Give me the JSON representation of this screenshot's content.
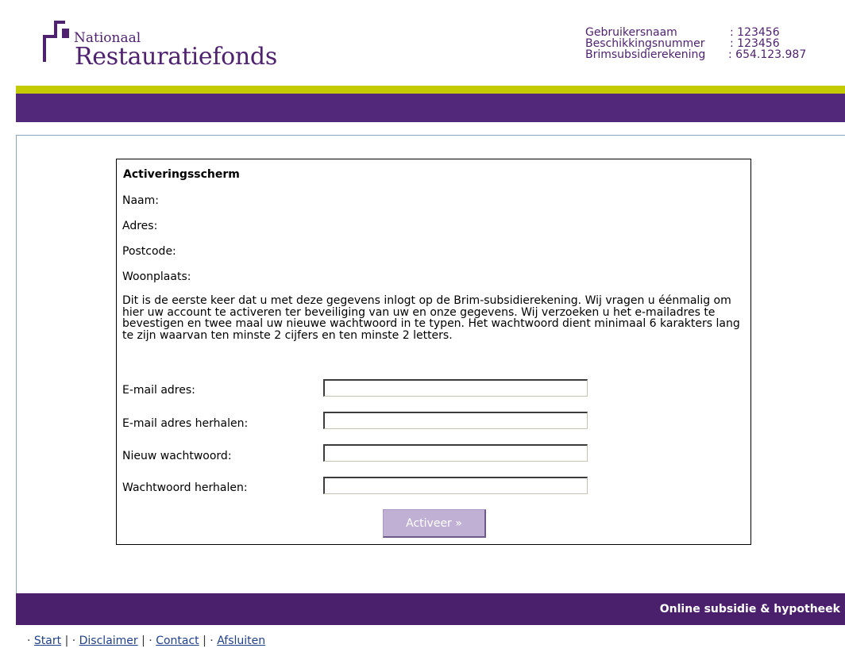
{
  "brand": {
    "line1": "Nationaal",
    "line2": "Restauratiefonds",
    "color": "#4f2270"
  },
  "userinfo": [
    {
      "label": "Gebruikersnaam",
      "value": ": 123456"
    },
    {
      "label": "Beschikkingsnummer",
      "value": ": 123456"
    },
    {
      "label": "Brimsubsidierekening",
      "value": ": 654.123.987"
    }
  ],
  "form": {
    "title": "Activeringsscherm",
    "fields": [
      "Naam:",
      "Adres:",
      "Postcode:",
      "Woonplaats:"
    ],
    "intro": "Dit is de eerste keer dat u met deze gegevens inlogt op de Brim-subsidierekening. Wij vragen u éénmalig om hier uw account te activeren ter beveiliging van uw en onze gegevens. Wij verzoeken u het e-mailadres te bevestigen en twee maal uw nieuwe wachtwoord in te typen. Het wachtwoord dient minimaal 6 karakters lang te zijn waarvan ten minste 2 cijfers en ten minste 2 letters.",
    "inputs": [
      {
        "label": "E-mail adres:",
        "value": ""
      },
      {
        "label": "E-mail adres herhalen:",
        "value": ""
      },
      {
        "label": "Nieuw wachtwoord:",
        "value": ""
      },
      {
        "label": "Wachtwoord herhalen:",
        "value": ""
      }
    ],
    "submit_label": "Activeer  »"
  },
  "footer": {
    "tagline": "Online subsidie & hypotheek",
    "links": [
      "Start",
      "Disclaimer",
      "Contact",
      "Afsluiten"
    ]
  },
  "colors": {
    "accent_lime": "#c3cb00",
    "brand_purple": "#52287a",
    "footer_purple": "#4a1f6c",
    "button": "#c0b0d4"
  }
}
